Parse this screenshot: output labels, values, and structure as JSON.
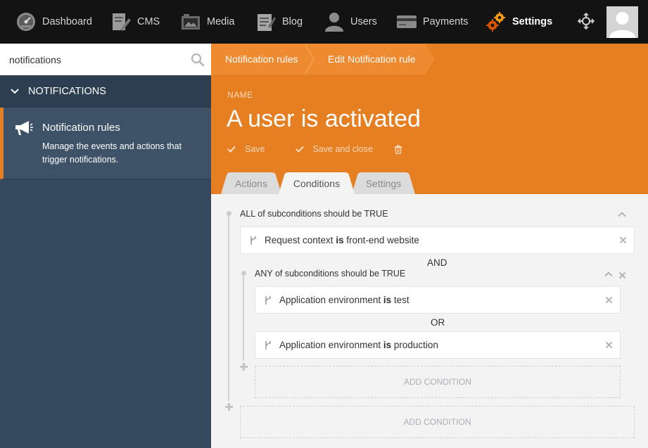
{
  "topnav": {
    "items": [
      {
        "label": "Dashboard",
        "icon": "dashboard-gauge-icon"
      },
      {
        "label": "CMS",
        "icon": "cms-document-icon"
      },
      {
        "label": "Media",
        "icon": "media-camera-icon"
      },
      {
        "label": "Blog",
        "icon": "blog-notepad-icon"
      },
      {
        "label": "Users",
        "icon": "users-person-icon"
      },
      {
        "label": "Payments",
        "icon": "payments-card-icon"
      },
      {
        "label": "Settings",
        "icon": "settings-gears-icon",
        "active": true
      }
    ]
  },
  "sidebar": {
    "search": {
      "value": "notifications"
    },
    "section_title": "NOTIFICATIONS",
    "item": {
      "title": "Notification rules",
      "description": "Manage the events and actions that trigger notifications."
    }
  },
  "breadcrumb": [
    "Notification rules",
    "Edit Notification rule"
  ],
  "header": {
    "name_label": "NAME",
    "title": "A user is activated",
    "save_label": "Save",
    "save_close_label": "Save and close"
  },
  "tabs": [
    {
      "label": "Actions",
      "active": false
    },
    {
      "label": "Conditions",
      "active": true
    },
    {
      "label": "Settings",
      "active": false
    }
  ],
  "conditions": {
    "root_label": "ALL of subconditions should be TRUE",
    "first": {
      "subject": "Request context",
      "op": "is",
      "value": "front-end website"
    },
    "and_label": "AND",
    "sub_label": "ANY of subconditions should be TRUE",
    "sub1": {
      "subject": "Application environment",
      "op": "is",
      "value": "test"
    },
    "or_label": "OR",
    "sub2": {
      "subject": "Application environment",
      "op": "is",
      "value": "production"
    },
    "add_label": "ADD CONDITION"
  },
  "colors": {
    "accent": "#e67e22",
    "sidebar": "#34495e",
    "nav": "#131313"
  }
}
